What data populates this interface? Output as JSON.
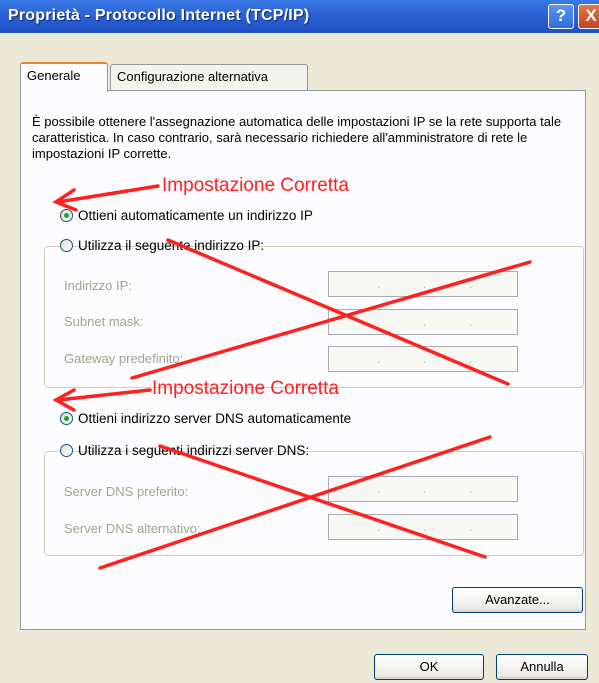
{
  "window": {
    "title": "Proprietà - Protocollo Internet (TCP/IP)",
    "help_symbol": "?",
    "close_symbol": "X"
  },
  "tabs": [
    {
      "label": "Generale",
      "active": true
    },
    {
      "label": "Configurazione alternativa",
      "active": false
    }
  ],
  "description": "È possibile ottenere l'assegnazione automatica delle impostazioni IP se la rete supporta tale caratteristica. In caso contrario, sarà necessario richiedere all'amministratore di rete le impostazioni IP corrette.",
  "ip_section": {
    "auto_label": "Ottieni automaticamente un indirizzo IP",
    "auto_checked": true,
    "manual_label": "Utilizza il seguente indirizzo IP:",
    "manual_checked": false,
    "fields": [
      {
        "label": "Indirizzo IP:"
      },
      {
        "label": "Subnet mask:"
      },
      {
        "label": "Gateway predefinito:"
      }
    ]
  },
  "dns_section": {
    "auto_label": "Ottieni indirizzo server DNS automaticamente",
    "auto_checked": true,
    "manual_label": "Utilizza i seguenti indirizzi server DNS:",
    "manual_checked": false,
    "fields": [
      {
        "label": "Server DNS preferito:"
      },
      {
        "label": "Server DNS alternativo:"
      }
    ]
  },
  "annotations": {
    "ip_note": "Impostazione Corretta",
    "dns_note": "Impostazione Corretta",
    "color": "#ff2020"
  },
  "buttons": {
    "advanced": "Avanzate...",
    "ok": "OK",
    "cancel": "Annulla"
  },
  "ip_separator": "."
}
